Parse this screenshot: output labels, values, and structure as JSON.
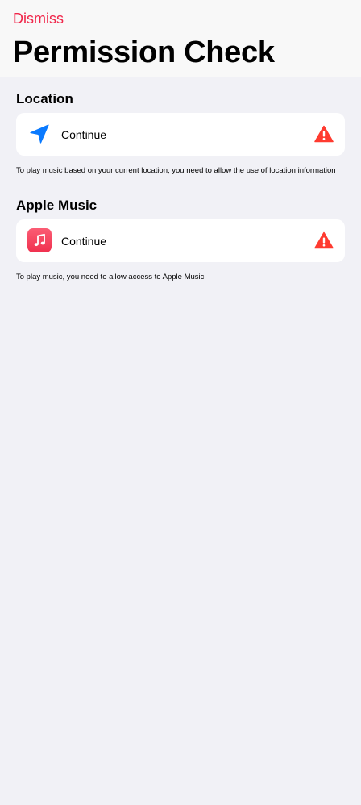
{
  "header": {
    "dismiss_label": "Dismiss",
    "title": "Permission Check"
  },
  "sections": [
    {
      "title": "Location",
      "item_label": "Continue",
      "icon": "location-arrow-icon",
      "status_icon": "warning-icon",
      "footnote": "To play music based on your current location, you need to allow the use of location information"
    },
    {
      "title": "Apple Music",
      "item_label": "Continue",
      "icon": "apple-music-icon",
      "status_icon": "warning-icon",
      "footnote": "To play music, you need to allow access to Apple Music"
    }
  ],
  "colors": {
    "accent": "#f0264a",
    "location_blue": "#0a7aff",
    "warning_red": "#ff3b30",
    "background": "#f1f1f6"
  }
}
